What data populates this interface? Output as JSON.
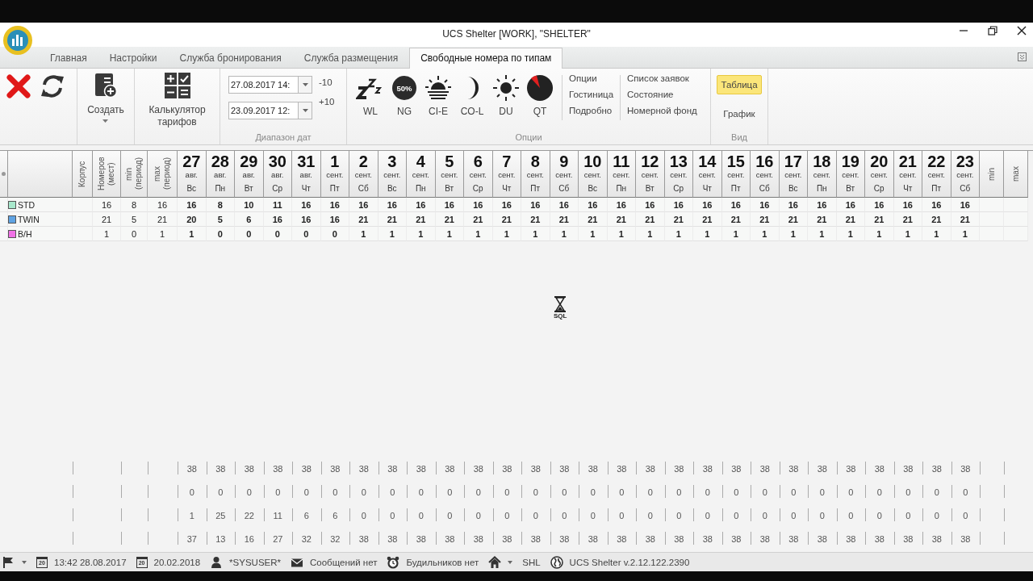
{
  "window": {
    "title": "UCS Shelter [WORK], \"SHELTER\""
  },
  "tabs": [
    {
      "label": "Главная",
      "selected": false
    },
    {
      "label": "Настройки",
      "selected": false
    },
    {
      "label": "Служба бронирования",
      "selected": false
    },
    {
      "label": "Служба размещения",
      "selected": false
    },
    {
      "label": "Свободные номера по типам",
      "selected": true
    }
  ],
  "ribbon": {
    "actions": [
      {
        "kind": "delete"
      },
      {
        "kind": "refresh"
      }
    ],
    "create": {
      "label": "Создать"
    },
    "calculator": {
      "label": "Калькулятор тарифов"
    },
    "date_range": {
      "label": "Диапазон дат",
      "from": "27.08.2017 14:",
      "to": "23.09.2017 12:",
      "minus": "-10",
      "plus": "+10"
    },
    "options": {
      "label": "Опции",
      "toggles": [
        {
          "kind": "wl",
          "label": "WL"
        },
        {
          "kind": "ng",
          "label": "NG",
          "badge": "50%"
        },
        {
          "kind": "ci-e",
          "label": "CI-E"
        },
        {
          "kind": "co-l",
          "label": "CO-L"
        },
        {
          "kind": "du",
          "label": "DU"
        },
        {
          "kind": "qt",
          "label": "QT"
        }
      ],
      "links": [
        [
          "Опции",
          "Гостиница",
          "Подробно"
        ],
        [
          "Список заявок",
          "Состояние",
          "Номерной фонд"
        ]
      ]
    },
    "view": {
      "label": "Вид",
      "items": [
        {
          "label": "Таблица",
          "selected": true
        },
        {
          "label": "График",
          "selected": false
        }
      ]
    }
  },
  "grid": {
    "columns": [
      "Корпус",
      "Номеров (мест)",
      "min (период)",
      "max (период)"
    ],
    "dates": [
      {
        "day": "27",
        "month": "авг.",
        "weekday": "Вс"
      },
      {
        "day": "28",
        "month": "авг.",
        "weekday": "Пн"
      },
      {
        "day": "29",
        "month": "авг.",
        "weekday": "Вт"
      },
      {
        "day": "30",
        "month": "авг.",
        "weekday": "Ср"
      },
      {
        "day": "31",
        "month": "авг.",
        "weekday": "Чт"
      },
      {
        "day": "1",
        "month": "сент.",
        "weekday": "Пт"
      },
      {
        "day": "2",
        "month": "сент.",
        "weekday": "Сб"
      },
      {
        "day": "3",
        "month": "сент.",
        "weekday": "Вс"
      },
      {
        "day": "4",
        "month": "сент.",
        "weekday": "Пн"
      },
      {
        "day": "5",
        "month": "сент.",
        "weekday": "Вт"
      },
      {
        "day": "6",
        "month": "сент.",
        "weekday": "Ср"
      },
      {
        "day": "7",
        "month": "сент.",
        "weekday": "Чт"
      },
      {
        "day": "8",
        "month": "сент.",
        "weekday": "Пт"
      },
      {
        "day": "9",
        "month": "сент.",
        "weekday": "Сб"
      },
      {
        "day": "10",
        "month": "сент.",
        "weekday": "Вс"
      },
      {
        "day": "11",
        "month": "сент.",
        "weekday": "Пн"
      },
      {
        "day": "12",
        "month": "сент.",
        "weekday": "Вт"
      },
      {
        "day": "13",
        "month": "сент.",
        "weekday": "Ср"
      },
      {
        "day": "14",
        "month": "сент.",
        "weekday": "Чт"
      },
      {
        "day": "15",
        "month": "сент.",
        "weekday": "Пт"
      },
      {
        "day": "16",
        "month": "сент.",
        "weekday": "Сб"
      },
      {
        "day": "17",
        "month": "сент.",
        "weekday": "Вс"
      },
      {
        "day": "18",
        "month": "сент.",
        "weekday": "Пн"
      },
      {
        "day": "19",
        "month": "сент.",
        "weekday": "Вт"
      },
      {
        "day": "20",
        "month": "сент.",
        "weekday": "Ср"
      },
      {
        "day": "21",
        "month": "сент.",
        "weekday": "Чт"
      },
      {
        "day": "22",
        "month": "сент.",
        "weekday": "Пт"
      },
      {
        "day": "23",
        "month": "сент.",
        "weekday": "Сб"
      }
    ],
    "tail_columns": [
      "min",
      "max"
    ],
    "rows": [
      {
        "name": "STD",
        "color": "#a8e8cc",
        "rooms": "16",
        "min": "8",
        "max": "16",
        "values": [
          "16",
          "8",
          "10",
          "11",
          "16",
          "16",
          "16",
          "16",
          "16",
          "16",
          "16",
          "16",
          "16",
          "16",
          "16",
          "16",
          "16",
          "16",
          "16",
          "16",
          "16",
          "16",
          "16",
          "16",
          "16",
          "16",
          "16",
          "16"
        ]
      },
      {
        "name": "TWIN",
        "color": "#5fa3e3",
        "rooms": "21",
        "min": "5",
        "max": "21",
        "values": [
          "20",
          "5",
          "6",
          "16",
          "16",
          "16",
          "21",
          "21",
          "21",
          "21",
          "21",
          "21",
          "21",
          "21",
          "21",
          "21",
          "21",
          "21",
          "21",
          "21",
          "21",
          "21",
          "21",
          "21",
          "21",
          "21",
          "21",
          "21"
        ]
      },
      {
        "name": "В/Н",
        "color": "#f072e6",
        "rooms": "1",
        "min": "0",
        "max": "1",
        "values": [
          "1",
          "0",
          "0",
          "0",
          "0",
          "0",
          "1",
          "1",
          "1",
          "1",
          "1",
          "1",
          "1",
          "1",
          "1",
          "1",
          "1",
          "1",
          "1",
          "1",
          "1",
          "1",
          "1",
          "1",
          "1",
          "1",
          "1",
          "1"
        ]
      }
    ],
    "totals": [
      {
        "values": [
          "38",
          "38",
          "38",
          "38",
          "38",
          "38",
          "38",
          "38",
          "38",
          "38",
          "38",
          "38",
          "38",
          "38",
          "38",
          "38",
          "38",
          "38",
          "38",
          "38",
          "38",
          "38",
          "38",
          "38",
          "38",
          "38",
          "38",
          "38"
        ]
      },
      {
        "values": [
          "0",
          "0",
          "0",
          "0",
          "0",
          "0",
          "0",
          "0",
          "0",
          "0",
          "0",
          "0",
          "0",
          "0",
          "0",
          "0",
          "0",
          "0",
          "0",
          "0",
          "0",
          "0",
          "0",
          "0",
          "0",
          "0",
          "0",
          "0"
        ]
      },
      {
        "values": [
          "1",
          "25",
          "22",
          "11",
          "6",
          "6",
          "0",
          "0",
          "0",
          "0",
          "0",
          "0",
          "0",
          "0",
          "0",
          "0",
          "0",
          "0",
          "0",
          "0",
          "0",
          "0",
          "0",
          "0",
          "0",
          "0",
          "0",
          "0"
        ]
      },
      {
        "values": [
          "37",
          "13",
          "16",
          "27",
          "32",
          "32",
          "38",
          "38",
          "38",
          "38",
          "38",
          "38",
          "38",
          "38",
          "38",
          "38",
          "38",
          "38",
          "38",
          "38",
          "38",
          "38",
          "38",
          "38",
          "38",
          "38",
          "38",
          "38"
        ]
      }
    ]
  },
  "loading": {
    "label": "SQL"
  },
  "status_bar": {
    "items": [
      {
        "kind": "flag"
      },
      {
        "kind": "date",
        "icon_text": "20",
        "text": "13:42 28.08.2017"
      },
      {
        "kind": "date",
        "icon_text": "20",
        "text": "20.02.2018"
      },
      {
        "kind": "user",
        "text": "*SYSUSER*"
      },
      {
        "kind": "mail",
        "text": "Сообщений нет"
      },
      {
        "kind": "alarm",
        "text": "Будильников нет"
      },
      {
        "kind": "home"
      },
      {
        "kind": "text",
        "text": "SHL"
      },
      {
        "kind": "globe",
        "text": "UCS Shelter v.2.12.122.2390"
      }
    ]
  }
}
